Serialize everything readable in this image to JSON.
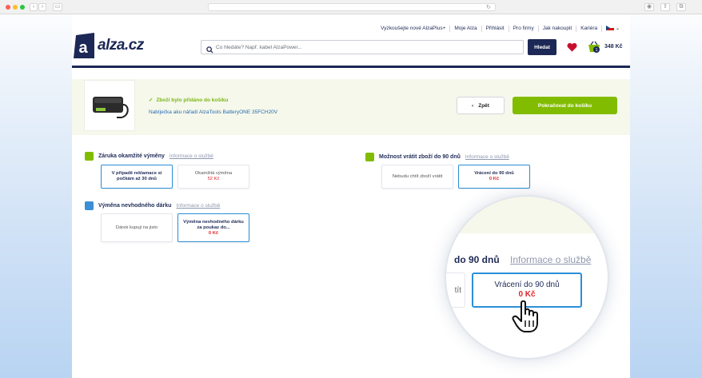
{
  "browser": {
    "url": "",
    "back": "‹",
    "forward": "›"
  },
  "header": {
    "links": [
      "Vyzkoušejte nové AlzaPlus+",
      "Moje Alza",
      "Přihlásit",
      "Pro firmy",
      "Jak nakoupit",
      "Kariéra"
    ],
    "logo_text": "alza.cz",
    "search_placeholder": "Co hledáte? Např. kabel AlzaPower...",
    "search_button": "Hledat",
    "cart_count": "1",
    "cart_price": "348 Kč"
  },
  "added": {
    "message": "Zboží bylo přidáno do košíku",
    "product": "Nabíječka aku nářadí AlzaTools BatteryONE 35FCH20V",
    "back_label": "Zpět",
    "continue_label": "Pokračovat do košíku"
  },
  "services": [
    {
      "title": "Záruka okamžité výměny",
      "info": "Informace o službě",
      "options": [
        {
          "label": "V případě reklamace si počkám až 30 dnů",
          "price": "",
          "selected": true
        },
        {
          "label": "Okamžitá výměna",
          "price": "52 Kč",
          "selected": false
        }
      ]
    },
    {
      "title": "Možnost vrátit zboží do 90 dnů",
      "info": "Informace o službě",
      "options": [
        {
          "label": "Nebudu chtít zboží vrátit",
          "price": "",
          "selected": false
        },
        {
          "label": "Vrácení do 90 dnů",
          "price": "0 Kč",
          "selected": true
        }
      ]
    },
    {
      "title": "Výměna nevhodného dárku",
      "info": "Informace o službě",
      "options": [
        {
          "label": "Dárek kupuji na jisto",
          "price": "",
          "selected": false
        },
        {
          "label": "Výměna nevhodného dárku za poukaz do...",
          "price": "0 Kč",
          "selected": true
        }
      ]
    }
  ],
  "magnifier": {
    "title": "do 90 dnů",
    "info": "Informace o službě",
    "left_fragment": "tít",
    "option_label": "Vrácení do 90 dnů",
    "option_price": "0 Kč"
  },
  "colors": {
    "brand_navy": "#1c2855",
    "green": "#82bc00",
    "selected_border": "#2b8fd6",
    "price_red": "#e0252b"
  }
}
